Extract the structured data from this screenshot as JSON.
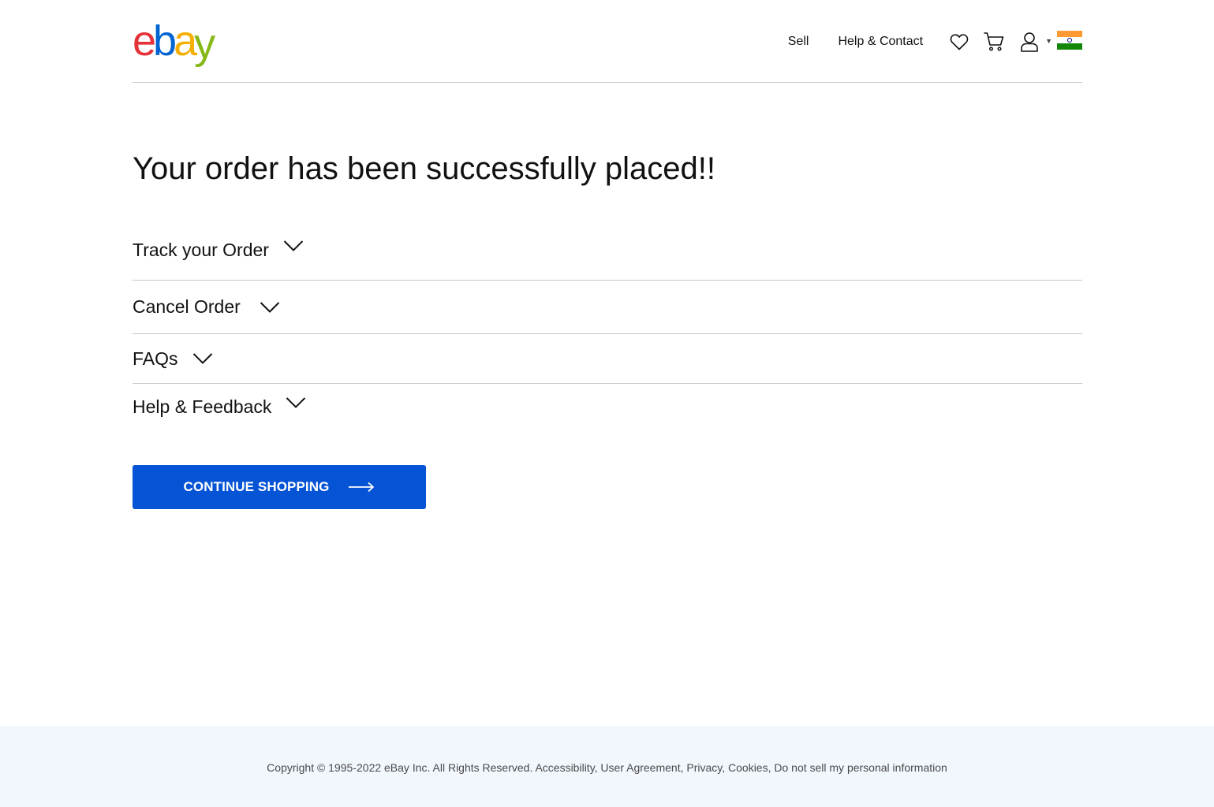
{
  "header": {
    "logo_letters": [
      "e",
      "b",
      "a",
      "y"
    ],
    "nav": {
      "sell": "Sell",
      "help_contact": "Help & Contact"
    },
    "icons": [
      "heart-icon",
      "cart-icon",
      "user-icon",
      "caret-down-icon",
      "india-flag-icon"
    ]
  },
  "main": {
    "headline": "Your order has been successfully placed!!",
    "accordion": [
      {
        "label": "Track your Order",
        "icon": "chevron-down-icon"
      },
      {
        "label": "Cancel Order",
        "icon": "chevron-down-icon"
      },
      {
        "label": "FAQs",
        "icon": "chevron-down-icon"
      },
      {
        "label": "Help & Feedback",
        "icon": "chevron-down-icon"
      }
    ],
    "cta": {
      "label": "CONTINUE SHOPPING",
      "icon": "arrow-right-icon"
    }
  },
  "footer": {
    "text": "Copyright © 1995-2022 eBay Inc. All Rights Reserved. Accessibility, User Agreement, Privacy, Cookies, Do not sell my personal information"
  },
  "colors": {
    "logo_e": "#e53238",
    "logo_b": "#0064d2",
    "logo_a": "#f5af02",
    "logo_y": "#86b817",
    "cta_background": "#0654d6",
    "footer_background": "#f2f6fd"
  }
}
